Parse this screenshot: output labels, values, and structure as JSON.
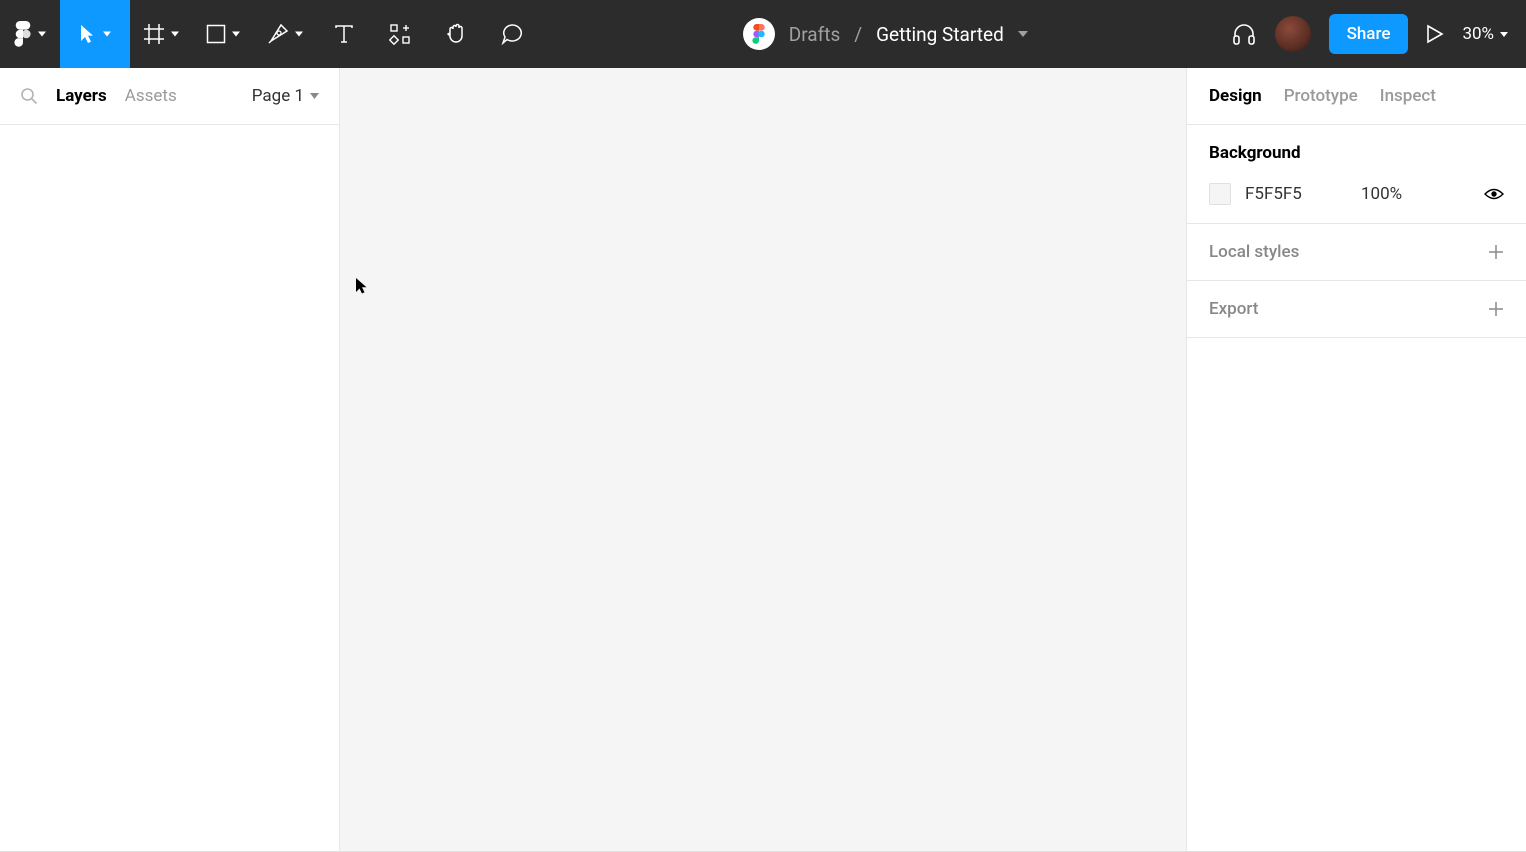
{
  "toolbar": {
    "breadcrumb_location": "Drafts",
    "breadcrumb_separator": "/",
    "breadcrumb_filename": "Getting Started",
    "share_label": "Share",
    "zoom_level": "30%"
  },
  "left_panel": {
    "tabs": {
      "layers": "Layers",
      "assets": "Assets"
    },
    "page_label": "Page 1"
  },
  "right_panel": {
    "tabs": {
      "design": "Design",
      "prototype": "Prototype",
      "inspect": "Inspect"
    },
    "background": {
      "title": "Background",
      "hex": "F5F5F5",
      "opacity": "100%"
    },
    "local_styles": {
      "title": "Local styles"
    },
    "export": {
      "title": "Export"
    }
  },
  "colors": {
    "toolbar_bg": "#2c2c2c",
    "accent": "#0d99ff",
    "canvas_bg": "#f5f5f5"
  }
}
